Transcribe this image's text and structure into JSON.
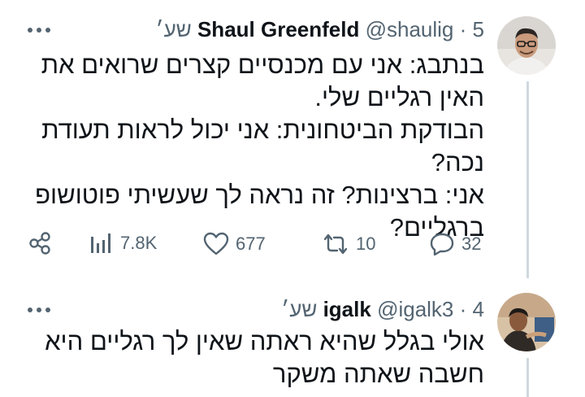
{
  "tweets": [
    {
      "author_name": "Shaul Greenfeld",
      "handle": "@shaulig",
      "separator": "·",
      "time": "5 שע׳",
      "text": "בנתבג: אני עם מכנסיים קצרים שרואים את האין רגליים שלי.\nהבודקת הביטחונית: אני יכול לראות תעודת נכה?\nאני: ברצינות? זה נראה לך שעשיתי פוטושופ ברגליים?",
      "actions": {
        "replies": "32",
        "retweets": "10",
        "likes": "677",
        "views": "7.8K"
      }
    },
    {
      "author_name": "igalk",
      "handle": "@igalk3",
      "separator": "·",
      "time": "4 שע׳",
      "text": "אולי בגלל שהיא ראתה שאין לך רגליים היא חשבה שאתה משקר"
    }
  ],
  "icons": {
    "more": "more-horizontal-icon",
    "reply": "reply-bubble-icon",
    "retweet": "retweet-arrows-icon",
    "like": "heart-icon",
    "views": "bar-chart-icon",
    "share": "share-nodes-icon"
  },
  "colors": {
    "text": "#0f1419",
    "secondary": "#536471",
    "thread_line": "#cfd9de"
  }
}
